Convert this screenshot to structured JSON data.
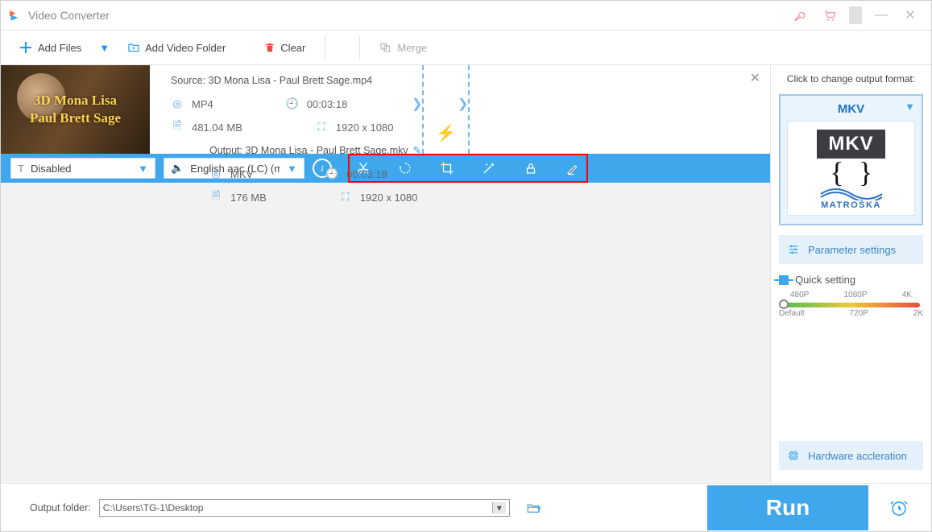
{
  "app": {
    "title": "Video Converter"
  },
  "toolbar": {
    "add_files": "Add Files",
    "add_folder": "Add Video Folder",
    "clear": "Clear",
    "merge": "Merge"
  },
  "thumb": {
    "line1": "3D Mona Lisa",
    "line2": "Paul Brett Sage"
  },
  "source": {
    "label": "Source: 3D Mona Lisa - Paul Brett Sage.mp4",
    "format": "MP4",
    "duration": "00:03:18",
    "size": "481.04 MB",
    "resolution": "1920 x 1080"
  },
  "output": {
    "label": "Output: 3D Mona Lisa - Paul Brett Sage.mkv",
    "format": "MKV",
    "duration": "00:03:18",
    "size": "176 MB",
    "resolution": "1920 x 1080"
  },
  "subs": {
    "mode": "Disabled"
  },
  "audio": {
    "track": "English aac (LC) (mp"
  },
  "right": {
    "change_label": "Click to change output format:",
    "format": "MKV",
    "mkv_badge": "MKV",
    "mkv_brand": "MATROŠKA",
    "param_btn": "Parameter settings",
    "quick_label": "Quick setting",
    "scale_top": [
      "480P",
      "1080P",
      "4K"
    ],
    "scale_bot": [
      "Default",
      "720P",
      "2K"
    ],
    "hwaccel": "Hardware accleration"
  },
  "footer": {
    "label": "Output folder:",
    "path": "C:\\Users\\TG-1\\Desktop",
    "run": "Run"
  }
}
